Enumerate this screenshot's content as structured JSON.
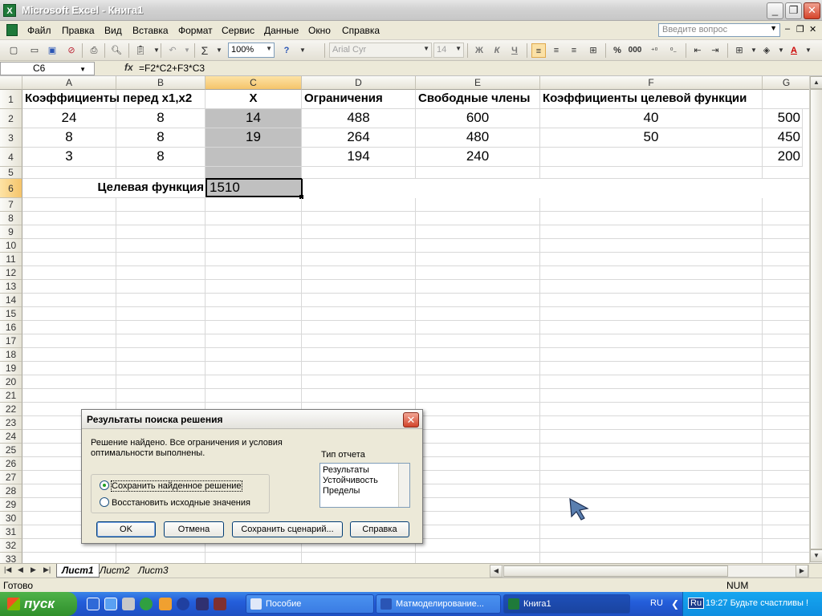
{
  "window": {
    "title": "Microsoft Excel - Книга1",
    "app_icon_letter": "X"
  },
  "menu": {
    "items": [
      "Файл",
      "Правка",
      "Вид",
      "Вставка",
      "Формат",
      "Сервис",
      "Данные",
      "Окно",
      "Справка"
    ],
    "ask_placeholder": "Введите вопрос"
  },
  "toolbar": {
    "zoom": "100%",
    "font_name": "Arial Cyr",
    "font_size": "14",
    "bold_label": "Ж",
    "italic_label": "К",
    "underline_label": "Ч",
    "sigma_label": "Σ",
    "percent_label": "%",
    "thousands_label": "000",
    "font_color_label": "A",
    "icons": [
      "new-icon",
      "open-icon",
      "save-icon",
      "permission-icon",
      "print-icon",
      "print-preview-icon",
      "paste-icon",
      "undo-icon",
      "autosum-icon",
      "help-icon",
      "align-left-icon",
      "align-center-icon",
      "align-right-icon",
      "merge-icon",
      "increase-decimal-icon",
      "decrease-decimal-icon",
      "decrease-indent-icon",
      "increase-indent-icon",
      "borders-icon",
      "fill-color-icon",
      "font-color-icon"
    ]
  },
  "formula_bar": {
    "name_box": "C6",
    "fx": "fx",
    "formula": "=F2*C2+F3*C3"
  },
  "grid": {
    "columns": [
      "A",
      "B",
      "C",
      "D",
      "E",
      "F",
      "G"
    ],
    "selected_column": "C",
    "selected_row": 6,
    "rows": [
      {
        "n": 1,
        "A": "Коэффициенты перед x1,x2",
        "B": "",
        "C": "X",
        "D": "Ограничения",
        "E": "Свободные члены",
        "F": "Коэффициенты целевой функции",
        "G": ""
      },
      {
        "n": 2,
        "A": "24",
        "B": "8",
        "C": "14",
        "D": "488",
        "E": "600",
        "F": "40",
        "G": "500"
      },
      {
        "n": 3,
        "A": "8",
        "B": "8",
        "C": "19",
        "D": "264",
        "E": "480",
        "F": "50",
        "G": "450"
      },
      {
        "n": 4,
        "A": "3",
        "B": "8",
        "C": "",
        "D": "194",
        "E": "240",
        "F": "",
        "G": "200"
      },
      {
        "n": 5
      },
      {
        "n": 6,
        "B": "Целевая функция",
        "C": "1510"
      }
    ],
    "row_numbers": [
      "1",
      "2",
      "3",
      "4",
      "5",
      "6",
      "7",
      "8",
      "9",
      "10",
      "11",
      "12",
      "13",
      "14",
      "15",
      "16",
      "17",
      "18",
      "19",
      "20",
      "21",
      "22",
      "23",
      "24",
      "25",
      "26",
      "27",
      "28",
      "29",
      "30",
      "31",
      "32",
      "33"
    ]
  },
  "sheets": {
    "tabs": [
      "Лист1",
      "Лист2",
      "Лист3"
    ],
    "active": "Лист1"
  },
  "status": {
    "ready": "Готово",
    "num": "NUM"
  },
  "dialog": {
    "title": "Результаты поиска решения",
    "message_line1": "Решение найдено. Все ограничения и условия",
    "message_line2": "оптимальности выполнены.",
    "report_type_label": "Тип отчета",
    "reports": [
      "Результаты",
      "Устойчивость",
      "Пределы"
    ],
    "radio_keep": "Сохранить найденное решение",
    "radio_restore": "Восстановить исходные значения",
    "btn_ok": "OK",
    "btn_cancel": "Отмена",
    "btn_save_scenario": "Сохранить сценарий...",
    "btn_help": "Справка"
  },
  "taskbar": {
    "start": "пуск",
    "tasks": [
      "Пособие",
      "Матмоделирование...",
      "Книга1"
    ],
    "active_task": "Книга1",
    "lang": "RU",
    "tray_lang": "Ru",
    "clock_text": "19:27 Будьте счастливы !"
  },
  "colors": {
    "selected_cell_fill": "#c0c0c0",
    "header_highlight": "#f5c46a",
    "taskbar_blue": "#245edb",
    "start_green": "#2f8f2b"
  }
}
